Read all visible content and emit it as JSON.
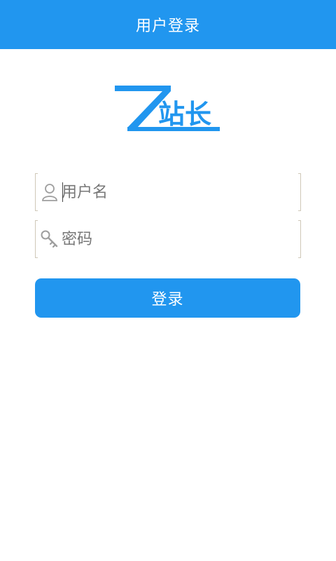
{
  "header": {
    "title": "用户登录"
  },
  "logo": {
    "letter": "Z",
    "text": "站长"
  },
  "form": {
    "username": {
      "placeholder": "用户名",
      "value": "",
      "icon": "user-icon"
    },
    "password": {
      "placeholder": "密码",
      "value": "",
      "icon": "key-icon"
    },
    "login_label": "登录"
  },
  "colors": {
    "primary": "#2196ef",
    "field_border": "#cfc8b8",
    "icon": "#9e9e9e"
  }
}
